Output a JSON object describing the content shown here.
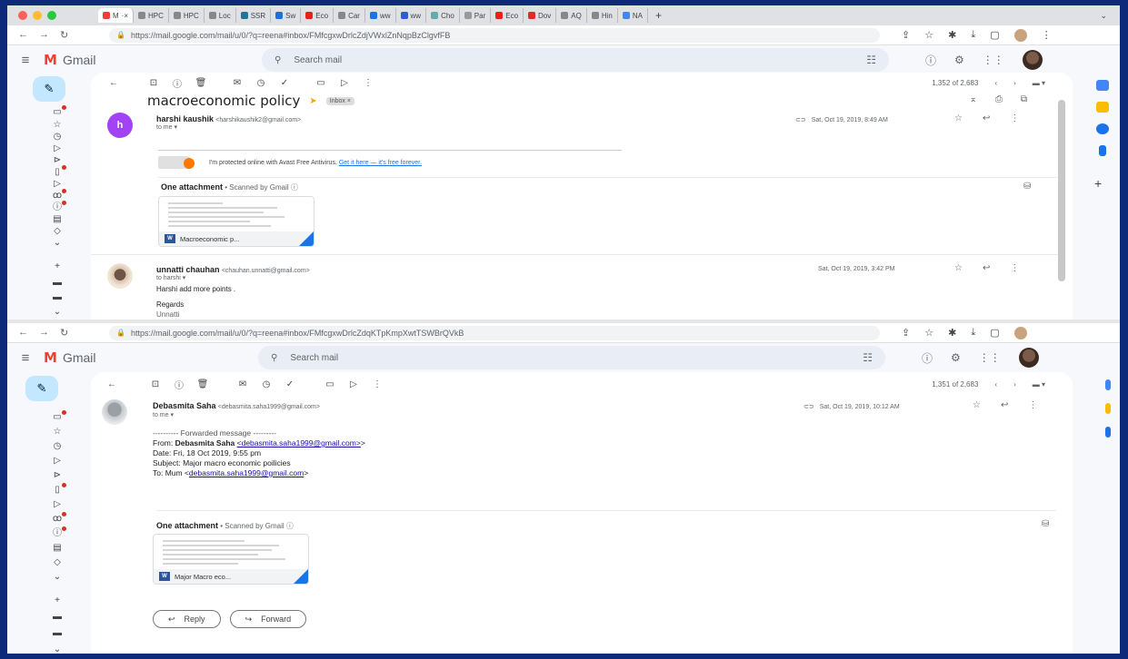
{
  "window1": {
    "tabs": [
      "M",
      "HPC",
      "HPC",
      "Loc",
      "SSR",
      "Sw",
      "Eco",
      "Car",
      "ww",
      "ww",
      "Cho",
      "Par",
      "Eco",
      "Dov",
      "AQ",
      "Hin",
      "NA"
    ],
    "url": "https://mail.google.com/mail/u/0/?q=reena#inbox/FMfcgxwDrlcZdjVWxlZnNqpBzClgvfFB",
    "app_name": "Gmail",
    "search_placeholder": "Search mail",
    "pager": "1,352 of 2,683",
    "subject": "macroeconomic policy",
    "label_chip": "Inbox ×",
    "message1": {
      "sender_name": "harshi kaushik",
      "sender_email": "<harshikaushik2@gmail.com>",
      "to": "to me",
      "date": "Sat, Oct 19, 2019, 8:49 AM",
      "avatar_letter": "h",
      "avast_text": "I'm protected online with Avast Free Antivirus.",
      "avast_link": "Get it here — it's free forever.",
      "attachments_label": "One attachment",
      "scanned": "• Scanned by Gmail ⓘ",
      "attachment_name": "Macroeconomic p..."
    },
    "message2": {
      "sender_name": "unnatti chauhan",
      "sender_email": "<chauhan.unnatti@gmail.com>",
      "to": "to harshi",
      "date": "Sat, Oct 19, 2019, 3:42 PM",
      "body_line1": "Harshi add more points .",
      "body_line2": "Regards",
      "body_line3": "Unnatti"
    }
  },
  "window2": {
    "url": "https://mail.google.com/mail/u/0/?q=reena#inbox/FMfcgxwDrlcZdqKTpKmpXwtTSWBrQVkB",
    "app_name": "Gmail",
    "search_placeholder": "Search mail",
    "pager": "1,351 of 2,683",
    "message": {
      "sender_name": "Debasmita Saha",
      "sender_email": "<debasmita.saha1999@gmail.com>",
      "to": "to me",
      "date": "Sat, Oct 19, 2019, 10:12 AM",
      "fwd_header": "---------- Forwarded message ---------",
      "from_label": "From:",
      "from_name": "Debasmita Saha",
      "from_email": "<debasmita.saha1999@gmail.com>",
      "from_close": ">",
      "date_line": "Date: Fri, 18 Oct 2019, 9:55 pm",
      "subject_line": "Subject: Major macro economic poilicies",
      "to_label": "To: Mum <",
      "to_email": "debasmita.saha1999@gmail.com",
      "to_close": ">",
      "attachments_label": "One attachment",
      "scanned": "• Scanned by Gmail ⓘ",
      "attachment_name": "Major Macro eco..."
    },
    "reply_label": "Reply",
    "forward_label": "Forward"
  },
  "colors": {
    "frame_border": "#0d2a7a",
    "compose_bg": "#c2e7ff",
    "link": "#1a0dab",
    "avatar_purple": "#a142f4"
  },
  "icons": [
    "menu-icon",
    "search-icon",
    "tune-icon",
    "help-icon",
    "settings-icon",
    "apps-icon",
    "pencil-icon",
    "inbox-icon",
    "star-icon",
    "clock-icon",
    "send-icon",
    "draft-icon",
    "label-icon",
    "archive-icon",
    "report-icon",
    "delete-icon",
    "mail-icon",
    "snooze-icon",
    "task-icon",
    "folder-icon",
    "more-icon",
    "back-icon",
    "reply-icon",
    "forward-icon",
    "drive-icon"
  ]
}
